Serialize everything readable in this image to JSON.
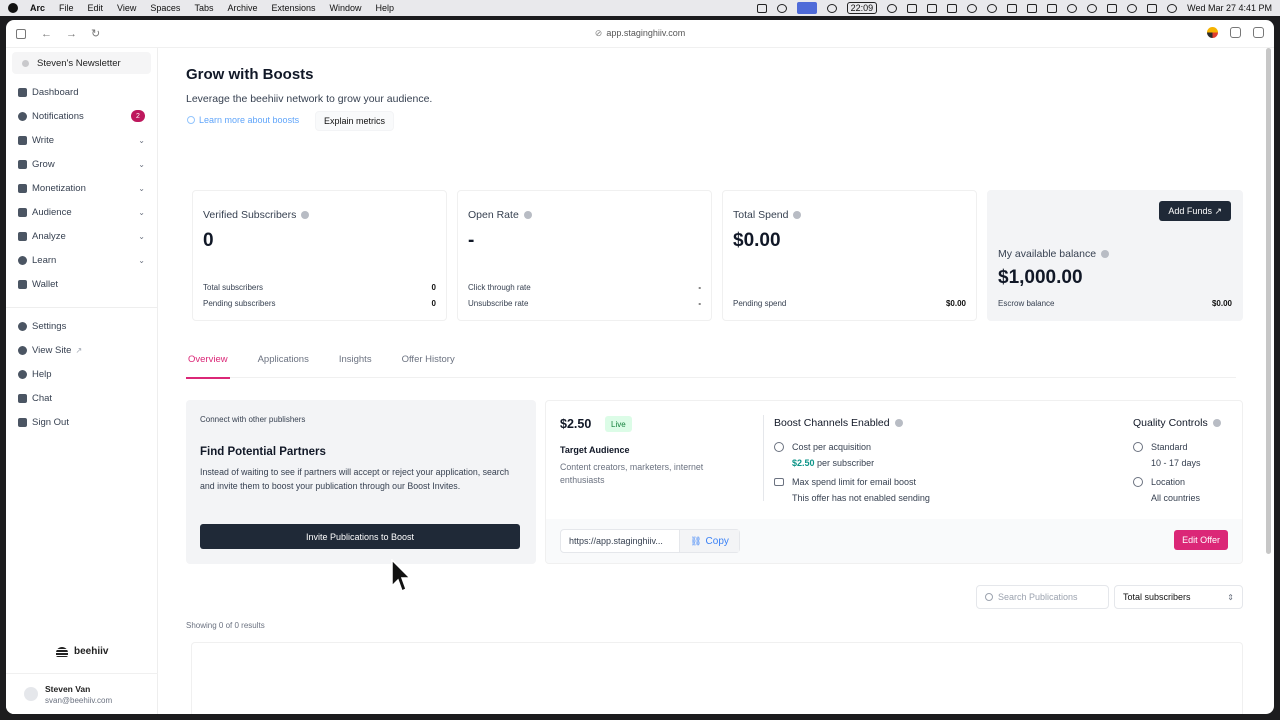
{
  "menubar": {
    "app": "Arc",
    "items": [
      "File",
      "Edit",
      "View",
      "Spaces",
      "Tabs",
      "Archive",
      "Extensions",
      "Window",
      "Help"
    ],
    "timer": "22:09",
    "clock": "Wed Mar 27  4:41 PM"
  },
  "browser": {
    "url": "app.staginghiiv.com"
  },
  "sidebar": {
    "publication": "Steven's Newsletter",
    "items": [
      {
        "label": "Dashboard",
        "icon": "grid-icon"
      },
      {
        "label": "Notifications",
        "icon": "bell-icon",
        "badge": "2"
      },
      {
        "label": "Write",
        "icon": "pencil-icon",
        "chevron": "⌄"
      },
      {
        "label": "Grow",
        "icon": "trend-icon",
        "chevron": "⌄"
      },
      {
        "label": "Monetization",
        "icon": "money-icon",
        "chevron": "⌄"
      },
      {
        "label": "Audience",
        "icon": "people-icon",
        "chevron": "⌄"
      },
      {
        "label": "Analyze",
        "icon": "bar-chart-icon",
        "chevron": "⌄"
      },
      {
        "label": "Learn",
        "icon": "bulb-icon",
        "chevron": "⌄"
      },
      {
        "label": "Wallet",
        "icon": "wallet-icon"
      }
    ],
    "secondary": [
      {
        "label": "Settings",
        "icon": "gear-icon"
      },
      {
        "label": "View Site",
        "icon": "globe-icon"
      },
      {
        "label": "Help",
        "icon": "help-icon"
      },
      {
        "label": "Chat",
        "icon": "chat-icon"
      },
      {
        "label": "Sign Out",
        "icon": "sign-out-icon"
      }
    ],
    "brand": "beehiiv",
    "user": {
      "name": "Steven Van",
      "email": "svan@beehiiv.com"
    }
  },
  "header": {
    "title": "Grow with Boosts",
    "subtitle": "Leverage the beehiiv network to grow your audience.",
    "learn_link": "Learn more about boosts",
    "explain_button": "Explain metrics"
  },
  "stats": {
    "verified": {
      "title": "Verified Subscribers",
      "value": "0",
      "rows": [
        {
          "label": "Total subscribers",
          "value": "0"
        },
        {
          "label": "Pending subscribers",
          "value": "0"
        }
      ]
    },
    "open_rate": {
      "title": "Open Rate",
      "value": "-",
      "rows": [
        {
          "label": "Click through rate",
          "value": "-"
        },
        {
          "label": "Unsubscribe rate",
          "value": "-"
        }
      ]
    },
    "spend": {
      "title": "Total Spend",
      "value": "$0.00",
      "rows": [
        {
          "label": "Pending spend",
          "value": "$0.00"
        }
      ]
    },
    "balance": {
      "button": "Add Funds ↗",
      "title": "My available balance",
      "value": "$1,000.00",
      "rows": [
        {
          "label": "Escrow balance",
          "value": "$0.00"
        }
      ]
    }
  },
  "tabs": [
    "Overview",
    "Applications",
    "Insights",
    "Offer History"
  ],
  "partners": {
    "eyebrow": "Connect with other publishers",
    "title": "Find Potential Partners",
    "description": "Instead of waiting to see if partners will accept or reject your application, search and invite them to boost your publication through our Boost Invites.",
    "button": "Invite Publications to Boost"
  },
  "offer": {
    "price": "$2.50",
    "status": "Live",
    "target_title": "Target Audience",
    "target_desc": "Content creators, marketers, internet enthusiasts",
    "channels_title": "Boost Channels Enabled",
    "cpa_label": "Cost per acquisition",
    "cpa_value": "$2.50",
    "cpa_suffix": "per subscriber",
    "max_label": "Max spend limit for email boost",
    "max_value": "This offer has not enabled sending",
    "quality_title": "Quality Controls",
    "standard_label": "Standard",
    "standard_value": "10 - 17 days",
    "location_label": "Location",
    "location_value": "All countries",
    "link": "https://app.staginghiiv...",
    "copy": "Copy",
    "edit": "Edit Offer"
  },
  "list": {
    "search_placeholder": "Search Publications",
    "sort": "Total subscribers",
    "showing": "Showing 0 of 0 results"
  }
}
